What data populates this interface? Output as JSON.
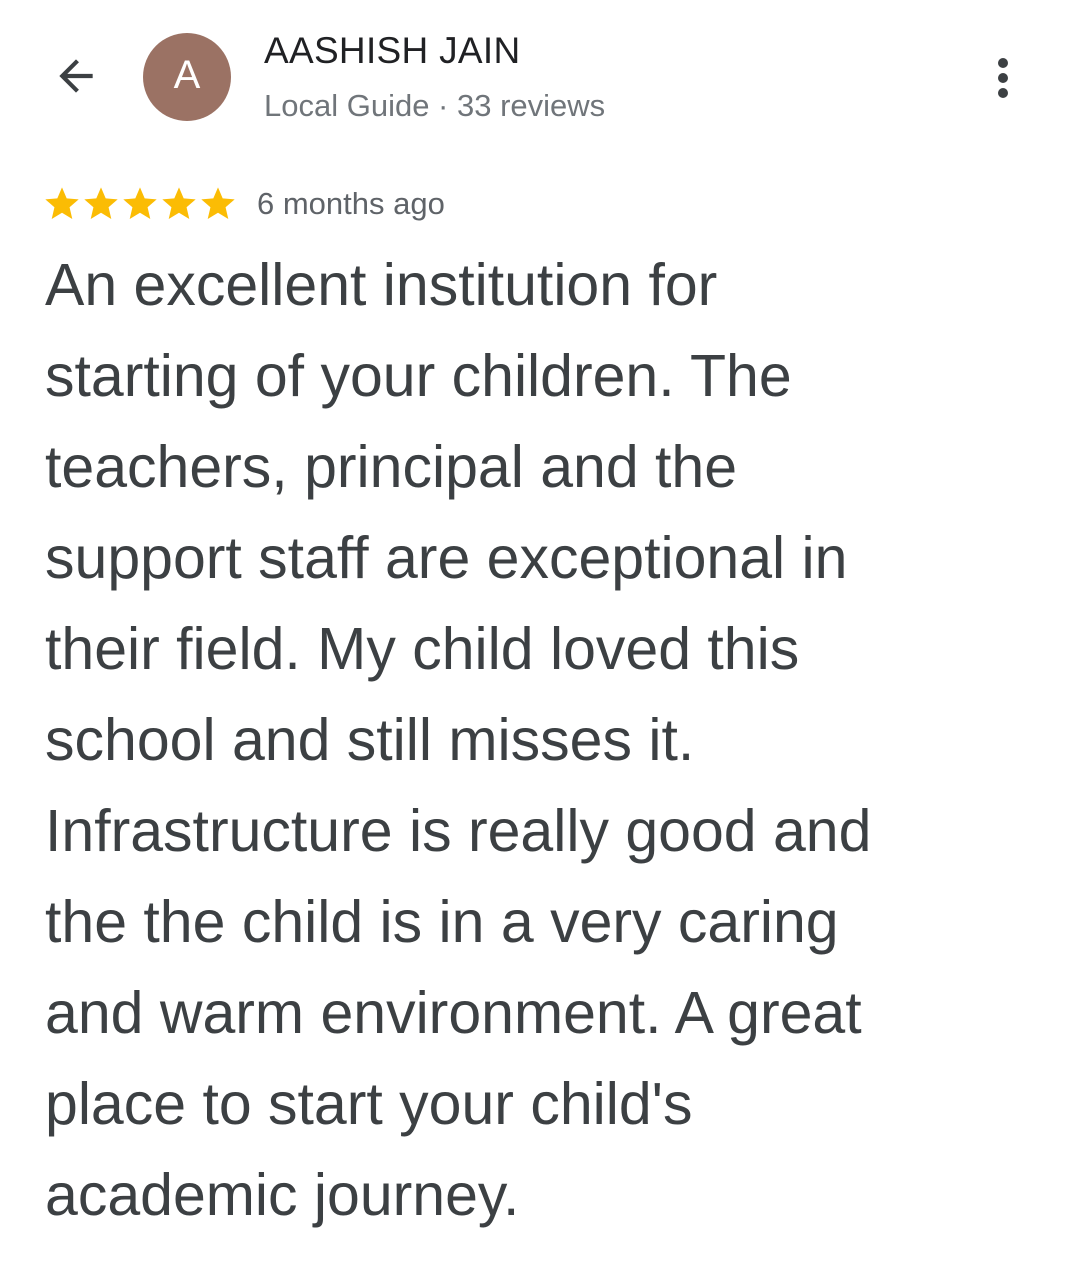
{
  "header": {
    "avatar_letter": "A",
    "avatar_color": "#9b7264",
    "reviewer_name": "AASHISH JAIN",
    "reviewer_meta": "Local Guide · 33 reviews",
    "back_icon": "arrow-left-icon",
    "more_icon": "more-vertical-icon"
  },
  "review": {
    "rating": 5,
    "rating_max": 5,
    "star_color": "#fbbc04",
    "time": "6 months ago",
    "body": "An excellent institution for\nstarting of your children. The\nteachers, principal and the\nsupport staff are exceptional in\ntheir field. My child loved this\nschool and still misses it.\nInfrastructure is really good and\nthe the child is in a very caring\nand warm environment. A great\nplace to start your child's\nacademic journey."
  }
}
